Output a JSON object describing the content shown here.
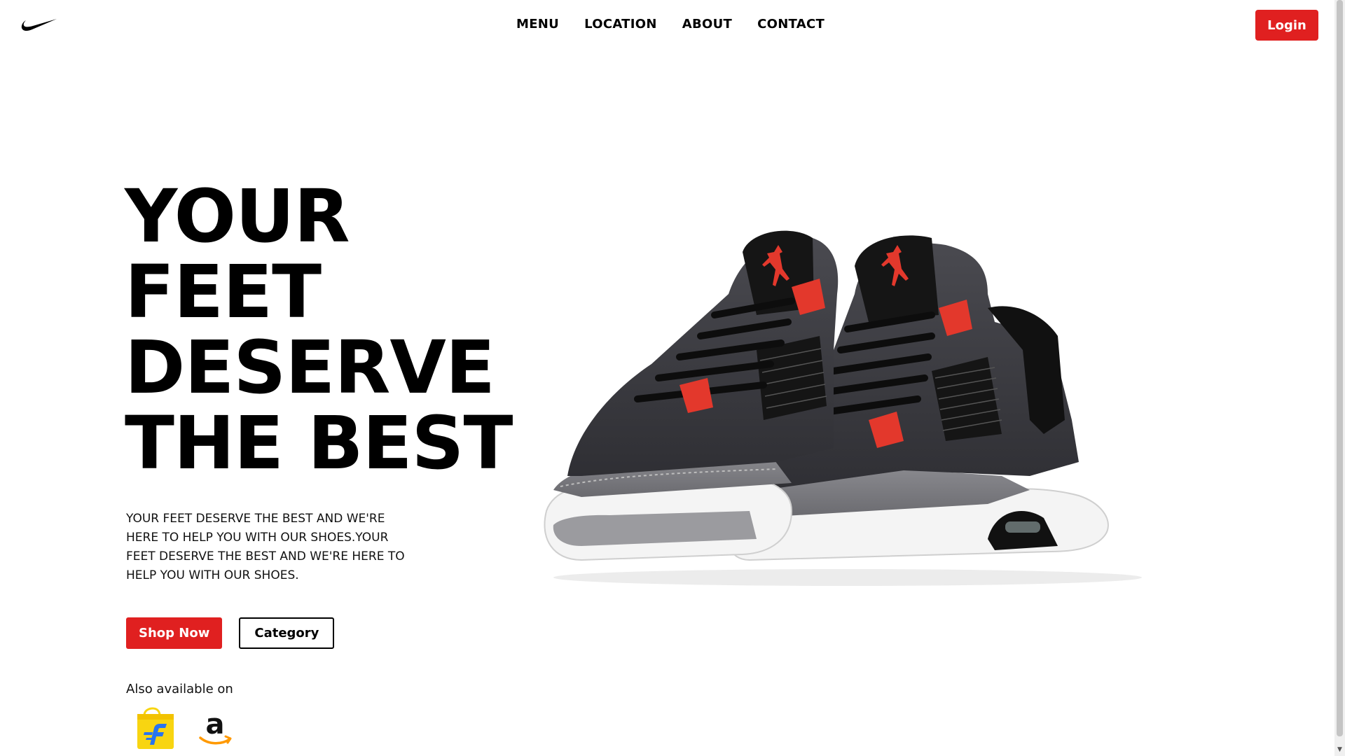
{
  "header": {
    "logo": "nike-swoosh-icon",
    "nav": [
      {
        "label": "MENU"
      },
      {
        "label": "LOCATION"
      },
      {
        "label": "ABOUT"
      },
      {
        "label": "CONTACT"
      }
    ],
    "login_label": "Login"
  },
  "hero": {
    "title_lines": [
      "YOUR",
      "FEET",
      "DESERVE",
      "THE BEST"
    ],
    "description": "YOUR FEET DESERVE THE BEST AND WE'RE HERE TO HELP YOU WITH OUR SHOES.YOUR FEET DESERVE THE BEST AND WE'RE HERE TO HELP YOU WITH OUR SHOES.",
    "shop_now_label": "Shop Now",
    "category_label": "Category",
    "available_label": "Also available on",
    "stores": [
      {
        "icon": "flipkart-icon"
      },
      {
        "icon": "amazon-icon"
      }
    ],
    "image": "air-jordan-4-sneakers-image"
  },
  "colors": {
    "accent": "#e02020",
    "text": "#000000",
    "shoe_dark_grey": "#3f3f44",
    "shoe_mid_grey": "#77777b",
    "shoe_red": "#e3382c",
    "flipkart_yellow": "#f8d511",
    "flipkart_blue": "#2874f0",
    "amazon_orange": "#ff9900"
  }
}
